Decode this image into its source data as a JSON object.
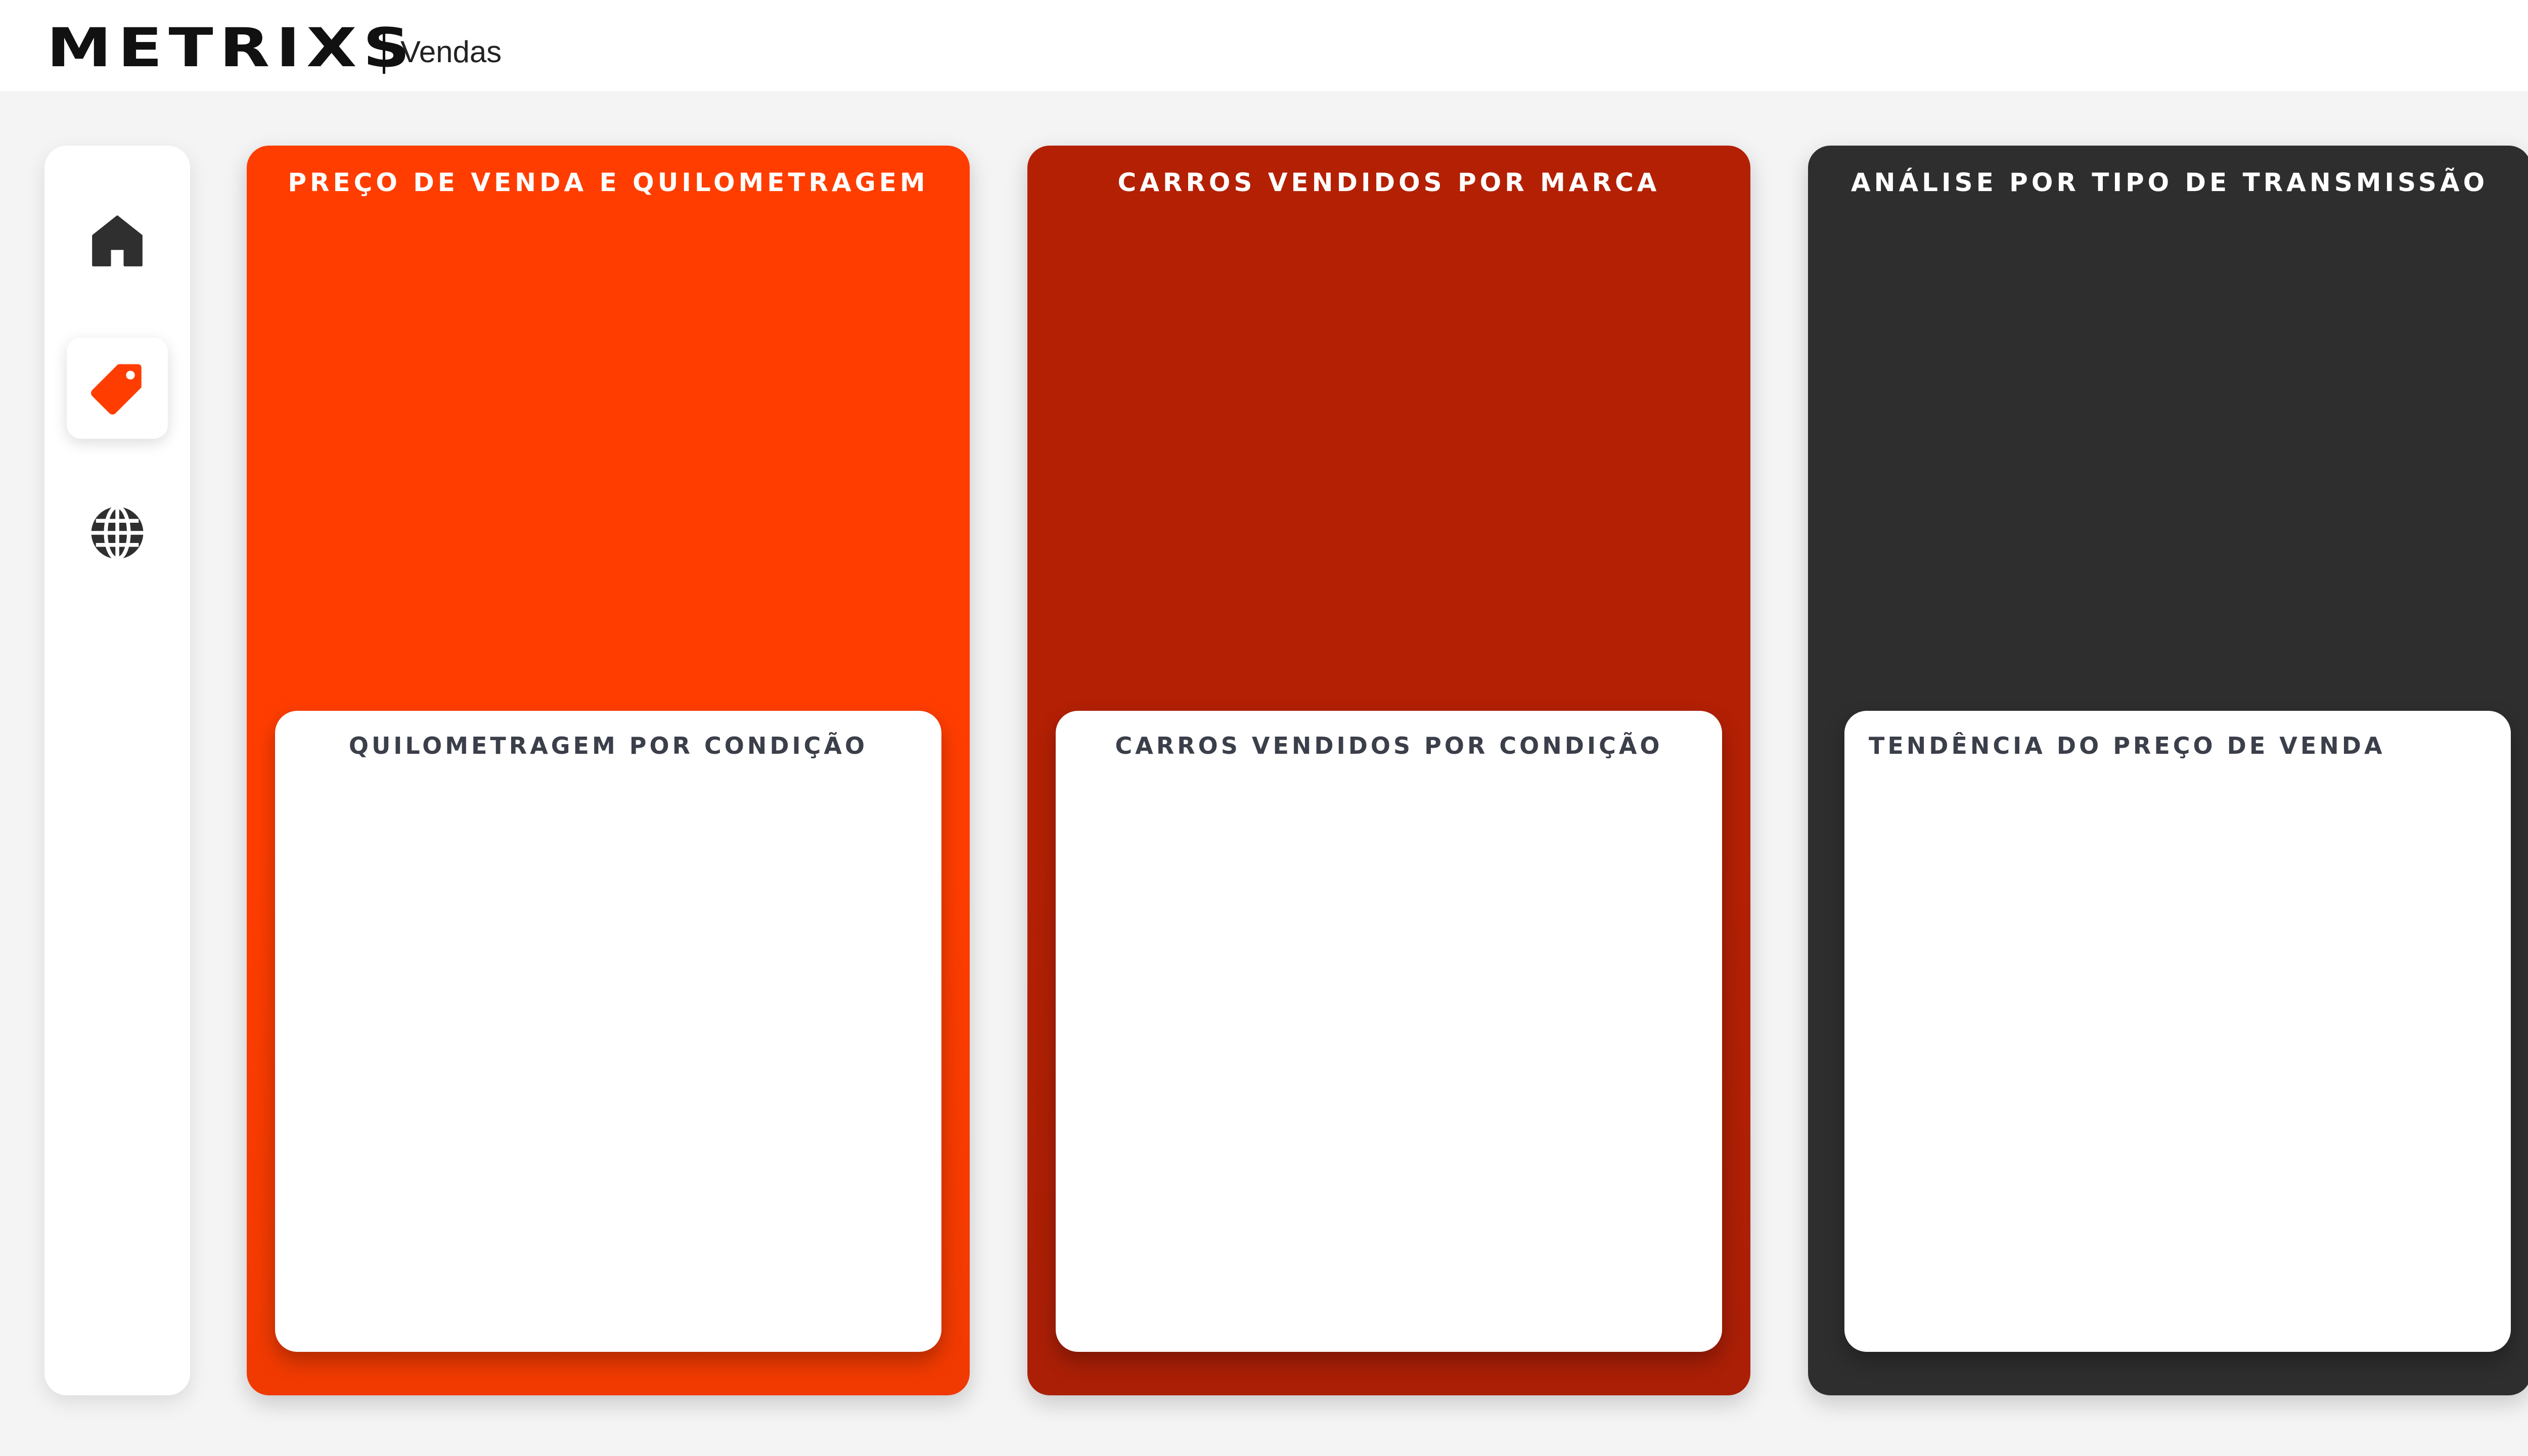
{
  "app": {
    "brand": "METRIXS",
    "section": "Vendas"
  },
  "sidebar": {
    "items": [
      {
        "icon": "home-icon",
        "active": false
      },
      {
        "icon": "price-tag-icon",
        "active": true
      },
      {
        "icon": "globe-icon",
        "active": false
      }
    ]
  },
  "colors": {
    "card1": "#ff3d00",
    "card2": "#b42004",
    "card3": "#2e2e2e",
    "accent": "#ff3d00",
    "icon": "#2f2f2f"
  },
  "cards": [
    {
      "title": "PREÇO DE VENDA E QUILOMETRAGEM",
      "inner_title": "QUILOMETRAGEM POR CONDIÇÃO"
    },
    {
      "title": "CARROS VENDIDOS POR MARCA",
      "inner_title": "CARROS VENDIDOS POR CONDIÇÃO"
    },
    {
      "title": "ANÁLISE POR TIPO DE TRANSMISSÃO",
      "inner_title": "TENDÊNCIA DO PREÇO DE VENDA"
    }
  ]
}
